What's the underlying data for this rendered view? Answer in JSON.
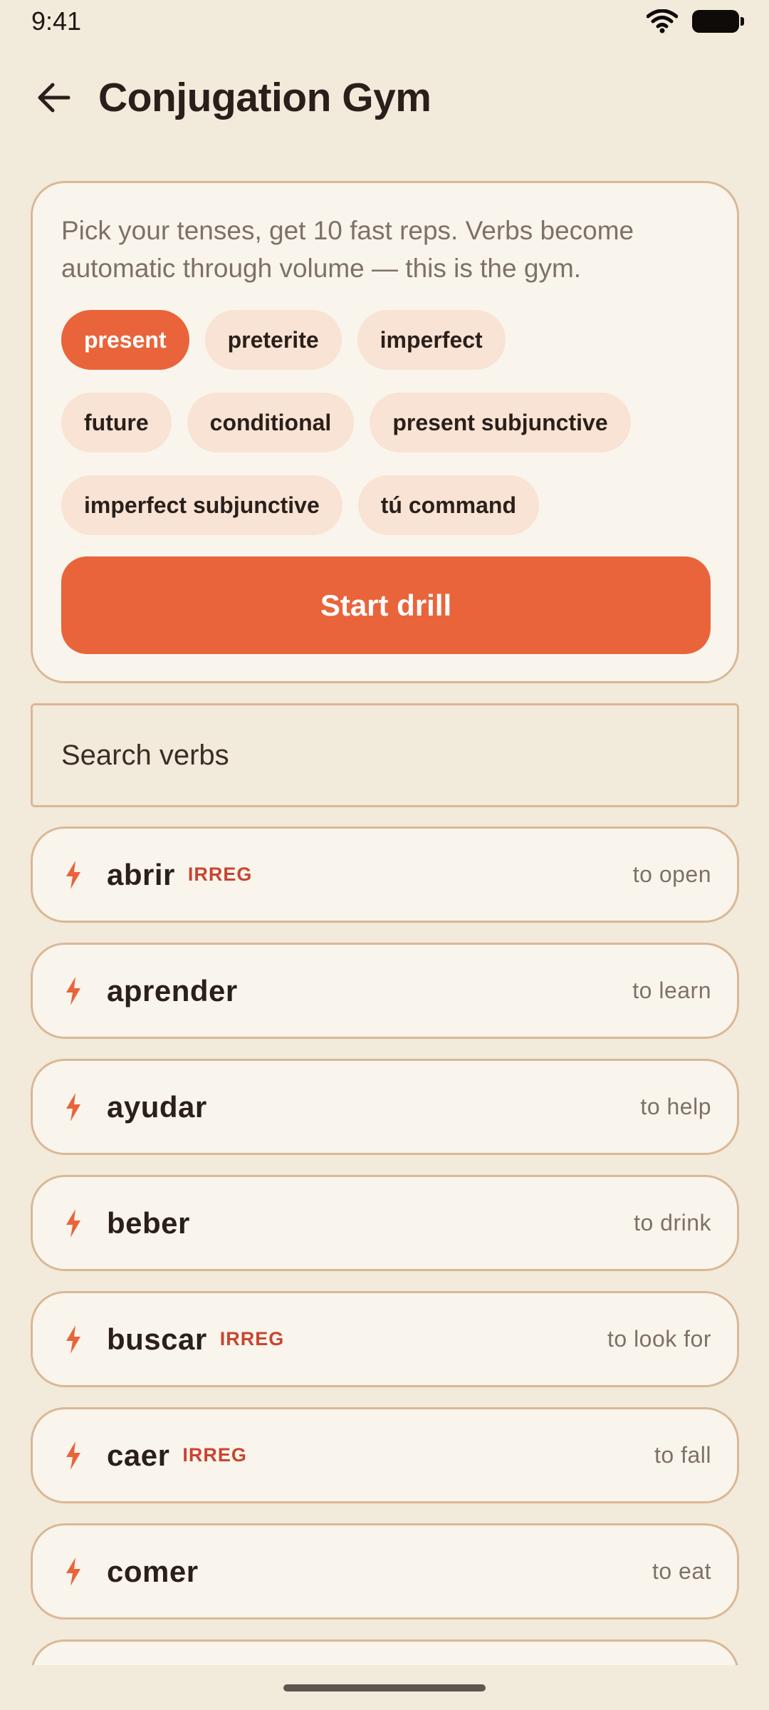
{
  "status_bar": {
    "time": "9:41"
  },
  "header": {
    "title": "Conjugation Gym"
  },
  "drill": {
    "description": "Pick your tenses, get 10 fast reps. Verbs become automatic through volume — this is the gym.",
    "tenses": [
      {
        "label": "present",
        "selected": true
      },
      {
        "label": "preterite",
        "selected": false
      },
      {
        "label": "imperfect",
        "selected": false
      },
      {
        "label": "future",
        "selected": false
      },
      {
        "label": "conditional",
        "selected": false
      },
      {
        "label": "present subjunctive",
        "selected": false
      },
      {
        "label": "imperfect subjunctive",
        "selected": false
      },
      {
        "label": "tú command",
        "selected": false
      }
    ],
    "start_label": "Start drill"
  },
  "search": {
    "placeholder": "Search verbs"
  },
  "verbs": [
    {
      "name": "abrir",
      "badge": "IRREG",
      "meaning": "to open"
    },
    {
      "name": "aprender",
      "badge": "",
      "meaning": "to learn"
    },
    {
      "name": "ayudar",
      "badge": "",
      "meaning": "to help"
    },
    {
      "name": "beber",
      "badge": "",
      "meaning": "to drink"
    },
    {
      "name": "buscar",
      "badge": "IRREG",
      "meaning": "to look for"
    },
    {
      "name": "caer",
      "badge": "IRREG",
      "meaning": "to fall"
    },
    {
      "name": "comer",
      "badge": "",
      "meaning": "to eat"
    }
  ],
  "colors": {
    "background": "#f2eadb",
    "accent": "#e9643b",
    "chip": "#f8e3d4",
    "card_border": "#d9b896",
    "irregular": "#c94530"
  }
}
